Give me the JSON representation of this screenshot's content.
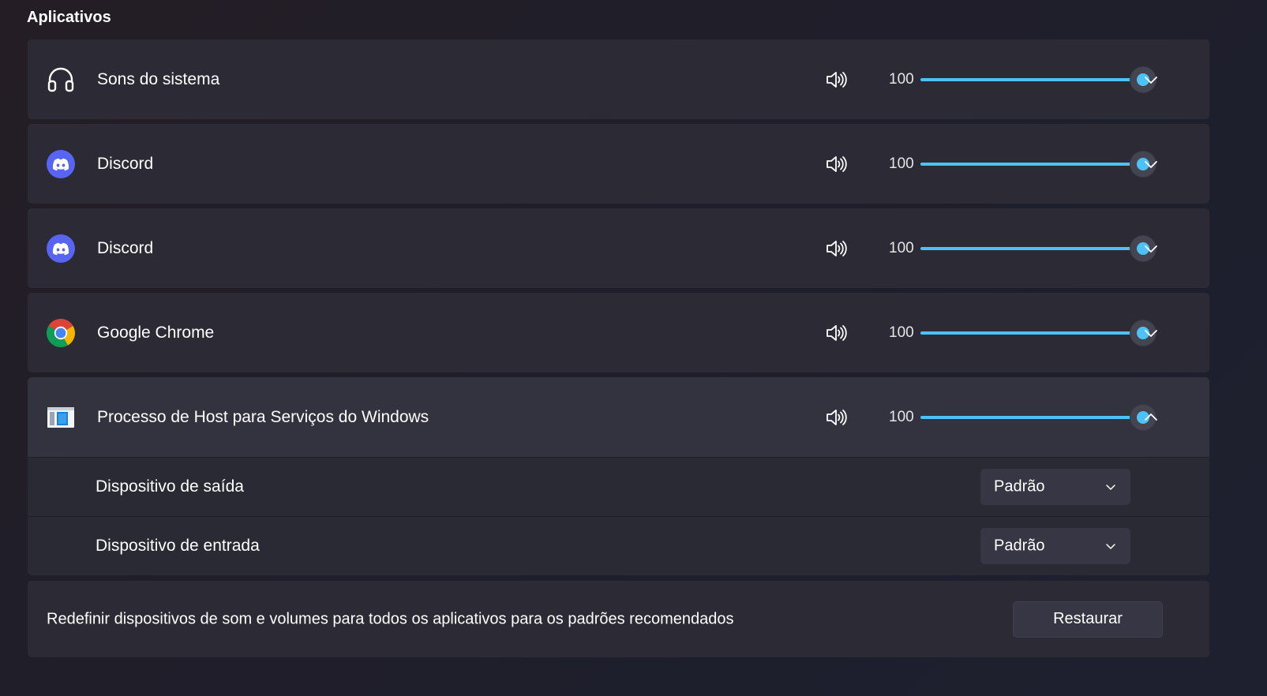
{
  "section": {
    "title": "Aplicativos"
  },
  "apps": [
    {
      "name": "Sons do sistema",
      "icon": "headphones-icon",
      "volume": 100,
      "volume_text": "100",
      "expanded": false
    },
    {
      "name": "Discord",
      "icon": "discord-icon",
      "volume": 100,
      "volume_text": "100",
      "expanded": false
    },
    {
      "name": "Discord",
      "icon": "discord-icon",
      "volume": 100,
      "volume_text": "100",
      "expanded": false
    },
    {
      "name": "Google Chrome",
      "icon": "chrome-icon",
      "volume": 100,
      "volume_text": "100",
      "expanded": false
    },
    {
      "name": "Processo de Host para Serviços do Windows",
      "icon": "windows-host-icon",
      "volume": 100,
      "volume_text": "100",
      "expanded": true
    }
  ],
  "expanded_options": {
    "output": {
      "label": "Dispositivo de saída",
      "value": "Padrão"
    },
    "input": {
      "label": "Dispositivo de entrada",
      "value": "Padrão"
    }
  },
  "reset": {
    "label": "Redefinir dispositivos de som e volumes para todos os aplicativos para os padrões recomendados",
    "button_label": "Restaurar"
  },
  "colors": {
    "accent": "#4ec2f7",
    "discord": "#5865f2",
    "card": "#2b2a35"
  }
}
